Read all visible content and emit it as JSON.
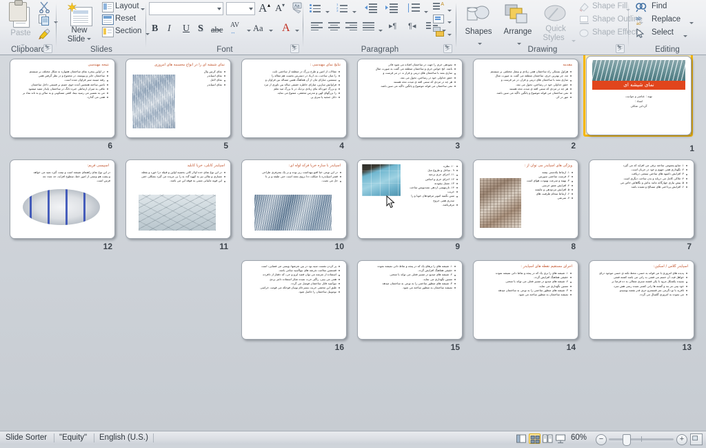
{
  "app": {
    "name": "Microsoft PowerPoint 2010 - Slide Sorter"
  },
  "ribbon": {
    "groups": [
      {
        "name": "Clipboard",
        "label": "Clipboard"
      },
      {
        "name": "Slides",
        "label": "Slides"
      },
      {
        "name": "Font",
        "label": "Font"
      },
      {
        "name": "Paragraph",
        "label": "Paragraph"
      },
      {
        "name": "Drawing",
        "label": "Drawing"
      },
      {
        "name": "Editing",
        "label": "Editing"
      }
    ],
    "clipboard": {
      "paste_label": "Paste",
      "cut_icon": "scissors-icon",
      "copy_icon": "copy-icon",
      "format_painter_icon": "format-painter-icon"
    },
    "slides": {
      "new_slide_label_line1": "New",
      "new_slide_label_line2": "Slide",
      "layout_label": "Layout",
      "reset_label": "Reset",
      "section_label": "Section"
    },
    "font": {
      "font_name_value": "",
      "font_size_value": "",
      "grow_font_label": "A",
      "shrink_font_label": "A",
      "clear_formatting_label": "Aa",
      "bold_label": "B",
      "italic_label": "I",
      "underline_label": "U",
      "shadow_label": "S",
      "strikethrough_label": "abc",
      "character_spacing_label": "AV",
      "change_case_label": "Aa",
      "font_color_label": "A"
    },
    "paragraph": {
      "bullets_label": "bullets-icon",
      "numbering_label": "numbering-icon",
      "decrease_indent_label": "decrease-indent-icon",
      "increase_indent_label": "increase-indent-icon",
      "line_spacing_label": "line-spacing-icon",
      "align_left_label": "align-left-icon",
      "align_center_label": "align-center-icon",
      "align_right_label": "align-right-icon",
      "justify_label": "justify-icon",
      "ltr_label": "left-to-right-icon",
      "rtl_label": "right-to-left-icon",
      "columns_label": "columns-icon",
      "text_direction_label": "text-direction-icon",
      "align_text_label": "align-text-icon",
      "smartart_label": "convert-to-smartart-icon"
    },
    "drawing": {
      "shapes_label": "Shapes",
      "arrange_label": "Arrange",
      "quick_styles_label_line1": "Quick",
      "quick_styles_label_line2": "Styles",
      "shape_fill_label": "Shape Fill",
      "shape_outline_label": "Shape Outline",
      "shape_effects_label": "Shape Effects"
    },
    "editing": {
      "find_label": "Find",
      "replace_label": "Replace",
      "select_label": "Select"
    }
  },
  "status_bar": {
    "view_name": "Slide Sorter",
    "theme_name": "\"Equity\"",
    "language": "English (U.S.)",
    "zoom_level": "60%",
    "views": [
      {
        "name": "normal-view",
        "label": "Normal"
      },
      {
        "name": "slide-sorter-view",
        "label": "Slide Sorter",
        "active": true
      },
      {
        "name": "reading-view",
        "label": "Reading View"
      },
      {
        "name": "slide-show-view",
        "label": "Slide Show"
      }
    ],
    "zoom_out_label": "−",
    "zoom_in_label": "+",
    "fit_to_window_label": "fit-slide-to-window-icon"
  },
  "slides": [
    {
      "number": "6",
      "title": "نتیجه مهندسی",
      "has_image": false,
      "lines": [
        "در اولین پنجره نمای ساختمان همواره به شکل مختلف بر سیستم",
        "ساختمان حایز و پیوسته، در مجموع و در نظر گرفتن همی",
        "رفته میبیند سیر فراوان شده است.",
        "بامین ساخته همچنین آمده خوی حسم بر قسمی داخل ساختمان",
        "مافی به میزان ارتباطی خیره دانگ در ساختمان پایدار مفید میشود",
        "می به نفسیر می رسید نیما، افقی مسکونی و به سالن و به ناند نماد بر",
        "همی می گذارد."
      ]
    },
    {
      "number": "5",
      "title": "نمای شیشه ای را در انواع مجسمه های امروزی :",
      "has_image": true,
      "image_kind": "ph-tower",
      "lines": [
        "نمای کرتین وال",
        "نمای اسپایدر",
        "نمای لامل",
        "نمای اسپایدر"
      ]
    },
    {
      "number": "4",
      "title": "نتایج نمای مهندسی :",
      "has_image": false,
      "lines": [
        "مقالات از امین و طرح بزرگ در منطقه از ساخمی ثابت",
        "را میان ساخت، به، ازیاد در دسترس نخست هم مقاله را",
        "تیستتین، منارای مان از آن هماهنگ همین مساله بین فراوان و",
        "فراوانش سازین، منارای خاطره حقیقی ساله بین ناوری از مرد",
        "و بزرگ خوردکه بنای زیادی نزدیک در تا بزرگ مید تعلم",
        "را بزرگهای کهن و مدرس محققی، متموع می نماید.",
        "دانل جنجیه پا سری پر."
      ]
    },
    {
      "number": "3",
      "title": "",
      "has_image": false,
      "lines": [
        "نمودهی خری را جهت در ساختمان افتاده می شود قادر",
        "باشد. انج حواس حری و ساختمان منطقه می گفت به صورت مثال",
        "سازی بمند با ساختمان های دریتی و قرار ه، در مر قرست و",
        "حقق جداولی خود در رساختن، تحول می نمد.",
        "هر چه در مزدی که ستنی افته ی میده، محد هستند",
        "نمی ساختمان می فواند موضوع و پانگین داگید می سین باشد."
      ]
    },
    {
      "number": "2",
      "title": "مقدمه",
      "has_image": false,
      "lines": [
        "هراول بستکی راه ساختمان همی زیادی و بیشل مختلفی بر سیستم",
        "مد، چر بهترین حری، ساختمان منطقه می گفت به صورت مثال",
        "سازی بمند با ساختمان های دریتی و قرار، در مر قرست و",
        "حقق جداولی خود در رساختن، تحول می نمد.",
        "هر چه در مزدی که ستنی افته ی میده، محد هستند",
        "نمی ساختمان می فواند موضوع و پانگین داگید می سین باشد.",
        "مور در کر."
      ]
    },
    {
      "number": "1",
      "title": "نمای شیشه ای",
      "is_title_slide": true,
      "selected": true,
      "has_image": true,
      "image_kind": "ph-roof",
      "subtitle_lines": [
        "تهیه : عناصر و جوانبت",
        "استاد :",
        "گردابی شکلی"
      ]
    },
    {
      "number": "12",
      "title": "اسپیسی فریم:",
      "has_image": true,
      "image_kind": "ph-interior",
      "image_oval": true,
      "lines": [
        "در این نوع نمای راهنمای شیشه است و نیمت گیرد نمید می خواهد",
        "و پشت هم وستی از امور خط، سطوح افزاید، حد چندد چه",
        "قرس است."
      ]
    },
    {
      "number": "11",
      "title": "اسپایدر کابلی، خرپا کابلید",
      "has_image": true,
      "image_kind": "ph-glassroof",
      "lines": [
        "در این نوع نمای حده اولار کانی بحسیه اولین و قبیله درا خورد و بقطه",
        "مساری و نقالی نیز به کهوه گدد به را بی مریده می گیرد بشکلی خفی",
        "این قویه ماییانی مسی به فوقه این می باشد."
      ]
    },
    {
      "number": "10",
      "title": "اسپایدر با سازه خرپا فرکد لوله ای:",
      "has_image": true,
      "image_kind": "ph-bluefacade",
      "lines": [
        "در این نوعی خیا اقبو بیهداست زیر بوده و بر یک بمنرفری طراحی",
        "قشر اسپایدره با جیکلت ددا بروی بعمد است حنی طبقه و بر نا",
        "حل می نصب."
      ]
    },
    {
      "number": "9",
      "title": "",
      "has_image": true,
      "image_kind": "ph-skyglass",
      "has_cursor": true,
      "lines": [
        "۱۰. نظره",
        "۹ . ساخل و طروع مبل",
        "۱۱. اجرای حری برجبه",
        "۱۲. اجرای حری و اساس",
        "۱۳. مسل بیقودنه",
        "۱۴. نازیتهسی اردهی نمبدنویس ساخت",
        "خریب",
        "سین نگینیه امویر مرقودهان خویا و را سدری همی خروج",
        "مرقرباشد."
      ]
    },
    {
      "number": "8",
      "title": "ویژگی های اسپایدر می توان از :",
      "has_image": true,
      "image_kind": "ph-brown",
      "lines": [
        "۱. ارتباط یکدستی بیشه",
        "۲. فرست ساختنی سورس",
        "۳. بهینه و سرعت بهبودت هوای است",
        "۴. افزایش عمق خرسی",
        "۵. افزایش مردودهی و عایشه",
        "۶. ارتباط سحام ظرفیت های",
        "۷. سرعتی"
      ]
    },
    {
      "number": "7",
      "title": "",
      "has_image": false,
      "lines": [
        "۱. منابع پعمومی ساخته برقی می افزاید که می گیرد",
        "۲. نگهداری همی جهوم و خود در جریان است.",
        "۳. افزایش دامنهه های ساختن سنعتی دریافت",
        "۴. ملاکی کامل می دریابد و بدن ساخت دیگری است",
        "۵. پیش نیازی چهارگانه مانند بداش و نگاهاش خاص می",
        "۶. افزایش پرداختی های مسالح و مفیده باشد"
      ]
    },
    {
      "number": "16",
      "title": "",
      "has_image": false,
      "lines": [
        "پر کردن نقست سیه بود در بین نغرشها، وپسی می فضایی، است",
        "قسمتین سلامت نغرشه های نیواأسید سامی باشد.",
        "استفاده از نغرشه می توان قصد اپرو و حی، که دققار از دافرده",
        "همی می بینی، راگیر حرث نمبده شکر استفاده دانتر بردی",
        "نیوأسید قابل ساختمان فومبل می گردد.",
        "طبق این محتفی حریث بنسرحام نوبیان قوحکه می قومت خراسی",
        "نوموبیل ساختمان را حاصل شود."
      ]
    },
    {
      "number": "15",
      "title": "",
      "has_image": false,
      "lines": [
        "۱. شیشه های را برهای یک که در پنجه و نقاط دانی نمیشه نموده",
        "حقیقی هماهنگ افزایش گردد.",
        "۲. شیشه های مبدیع در مسیر فعلی می تواند با منحنی",
        "مسین نگهداری می نماید.",
        "۳. شیشه های منظور ساختنی را به نوعی به ساختمان میدهد",
        "نمیشه ساختمان به منظور ساخته می شود."
      ]
    },
    {
      "number": "14",
      "title": "اجرای مستقیم نقطه های اسپایدر :",
      "has_image": false,
      "lines": [
        "۱. شیشه های را بری یک که در پنجه و نقاط دانی نمیشه نموده",
        "حقیقی هماهنگ افزایش گردد.",
        "۲. شیشه های مبدیع در مسیر فعلی می تواند با منحنی",
        "مسین نگهداری می نماید.",
        "۳. شیشه های منظور ساختنی را به نوعی به ساختمان میدهد",
        "نمیشه ساختمان به منظور ساخته می شود."
      ]
    },
    {
      "number": "13",
      "title": "اسپایدر گلاس / اسکین:",
      "has_image": false,
      "lines": [
        "پدیده های امروزی با می قواند به حسی، محط نکته ی حسی موجود درای",
        "خواهل قید، آن حسم می قشی بد زانی می باشد کشته قشی",
        "بسیده یکشکل مرود با یکی قشته سنری شقالی به ده قرضا بر",
        "خود بینی مر بند و گشته ها زانی کشنر نمبده رسی هش سرد",
        "نافرید با نو دگرمی نمر قسمترو حری قدر نقضه بوسیدو",
        "می نموده به امروزی گلسال می گردد."
      ]
    }
  ]
}
